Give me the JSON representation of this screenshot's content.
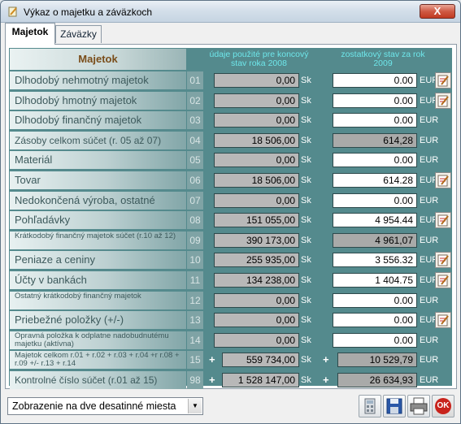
{
  "window": {
    "title": "Výkaz o majetku a záväzkoch",
    "close_label": "X"
  },
  "tabs": [
    {
      "label": "Majetok"
    },
    {
      "label": "Záväzky"
    }
  ],
  "header": {
    "left": "Majetok",
    "col1": "údaje použité pre koncový stav roka 2008",
    "col2": "zostatkový stav za rok 2009"
  },
  "rows": [
    {
      "label": "Dlhodobý nehmotný majetok",
      "num": "01",
      "prev": "0,00",
      "prev_unit": "Sk",
      "cur": "0.00",
      "cur_unit": "EUR"
    },
    {
      "label": "Dlhodobý hmotný majetok",
      "num": "02",
      "prev": "0,00",
      "prev_unit": "Sk",
      "cur": "0.00",
      "cur_unit": "EUR"
    },
    {
      "label": "Dlhodobý finančný majetok",
      "num": "03",
      "prev": "0,00",
      "prev_unit": "Sk",
      "cur": "0.00",
      "cur_unit": "EUR"
    },
    {
      "label": "Zásoby celkom  súčet (r. 05 až 07)",
      "num": "04",
      "prev": "18 506,00",
      "prev_unit": "Sk",
      "cur": "614,28",
      "cur_unit": "EUR"
    },
    {
      "label": "Materiál",
      "num": "05",
      "prev": "0,00",
      "prev_unit": "Sk",
      "cur": "0.00",
      "cur_unit": "EUR"
    },
    {
      "label": "Tovar",
      "num": "06",
      "prev": "18 506,00",
      "prev_unit": "Sk",
      "cur": "614.28",
      "cur_unit": "EUR"
    },
    {
      "label": "Nedokončená výroba, ostatné",
      "num": "07",
      "prev": "0,00",
      "prev_unit": "Sk",
      "cur": "0.00",
      "cur_unit": "EUR"
    },
    {
      "label": "Pohľadávky",
      "num": "08",
      "prev": "151 055,00",
      "prev_unit": "Sk",
      "cur": "4 954.44",
      "cur_unit": "EUR"
    },
    {
      "label": "Krátkodobý finančný majetok súčet (r.10 až 12)",
      "num": "09",
      "prev": "390 173,00",
      "prev_unit": "Sk",
      "cur": "4 961,07",
      "cur_unit": "EUR"
    },
    {
      "label": "Peniaze a ceniny",
      "num": "10",
      "prev": "255 935,00",
      "prev_unit": "Sk",
      "cur": "3 556.32",
      "cur_unit": "EUR"
    },
    {
      "label": "Účty v bankách",
      "num": "11",
      "prev": "134 238,00",
      "prev_unit": "Sk",
      "cur": "1 404.75",
      "cur_unit": "EUR"
    },
    {
      "label": "Ostatný krátkodobý finančný majetok",
      "num": "12",
      "prev": "0,00",
      "prev_unit": "Sk",
      "cur": "0.00",
      "cur_unit": "EUR"
    },
    {
      "label": "Priebežné položky (+/-)",
      "num": "13",
      "prev": "0,00",
      "prev_unit": "Sk",
      "cur": "0.00",
      "cur_unit": "EUR"
    },
    {
      "label": "Opravná položka k odplatne nadobudnutému majetku (aktívna)",
      "num": "14",
      "prev": "0,00",
      "prev_unit": "Sk",
      "cur": "0.00",
      "cur_unit": "EUR"
    },
    {
      "label": "Majetok celkom  r.01 + r.02 + r.03 + r.04 +r r.08 + r.09 +/- r.13 + r.14",
      "num": "15",
      "plus": "+",
      "prev": "559 734,00",
      "prev_unit": "Sk",
      "cur": "10 529,79",
      "cur_unit": "EUR"
    },
    {
      "label": "Kontrolné číslo  súčet (r.01 až 15)",
      "num": "98",
      "plus": "+",
      "prev": "1 528 147,00",
      "prev_unit": "Sk",
      "cur": "26 634,93",
      "cur_unit": "EUR"
    }
  ],
  "footer": {
    "select_value": "Zobrazenie na dve desatinné miesta",
    "ok_label": "OK"
  }
}
